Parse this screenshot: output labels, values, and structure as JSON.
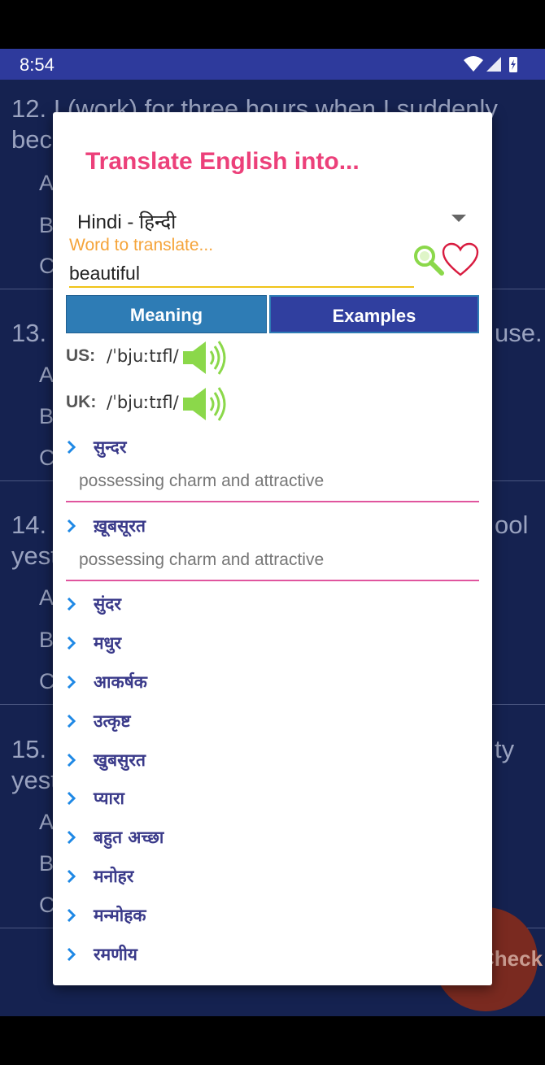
{
  "status_bar": {
    "time": "8:54"
  },
  "background": {
    "questions": [
      {
        "text": "12. I (work) for three hours when I suddenly",
        "line2": "became",
        "options": [
          "A",
          "B",
          "C"
        ]
      },
      {
        "text": "13. ",
        "line2": "",
        "tail": "use.",
        "options": [
          "A",
          "B",
          "C"
        ]
      },
      {
        "text": "14. ",
        "line2": "yesterday",
        "tail": "ool",
        "options": [
          "A",
          "B",
          "C"
        ]
      },
      {
        "text": "15. ",
        "line2": "yesterday",
        "tail": "ty",
        "options": [
          "A",
          "B",
          "C"
        ]
      }
    ],
    "fab_label": "Check"
  },
  "dialog": {
    "title": "Translate English into...",
    "language": {
      "selected": "Hindi - हिन्दी"
    },
    "word_field": {
      "hint": "Word to translate...",
      "value": "beautiful"
    },
    "icons": {
      "search": "search-icon",
      "favorite": "heart-icon"
    },
    "tabs": [
      {
        "label": "Meaning"
      },
      {
        "label": "Examples"
      }
    ],
    "pronunciations": [
      {
        "label": "US:",
        "ipa": "/ˈbjuːtɪfl/"
      },
      {
        "label": "UK:",
        "ipa": "/ˈbjuːtɪfl/"
      }
    ],
    "meanings": [
      {
        "word": "सुन्दर",
        "definition": "possessing charm and attractive"
      },
      {
        "word": "ख़ूबसूरत",
        "definition": "possessing charm and attractive"
      },
      {
        "word": "सुंदर"
      },
      {
        "word": "मधुर"
      },
      {
        "word": "आकर्षक"
      },
      {
        "word": "उत्कृष्ट"
      },
      {
        "word": "खुबसुरत"
      },
      {
        "word": "प्यारा"
      },
      {
        "word": "बहुत अच्छा"
      },
      {
        "word": "मनोहर"
      },
      {
        "word": "मन्मोहक"
      },
      {
        "word": "रमणीय"
      }
    ]
  },
  "colors": {
    "title": "#ec407a",
    "hint": "#f5a43a",
    "tab_meaning": "#2e7cb5",
    "tab_examples": "#303f9f",
    "meaning_word": "#3a3a8a",
    "divider": "#e0559e",
    "icon_green": "#8bd84a"
  }
}
